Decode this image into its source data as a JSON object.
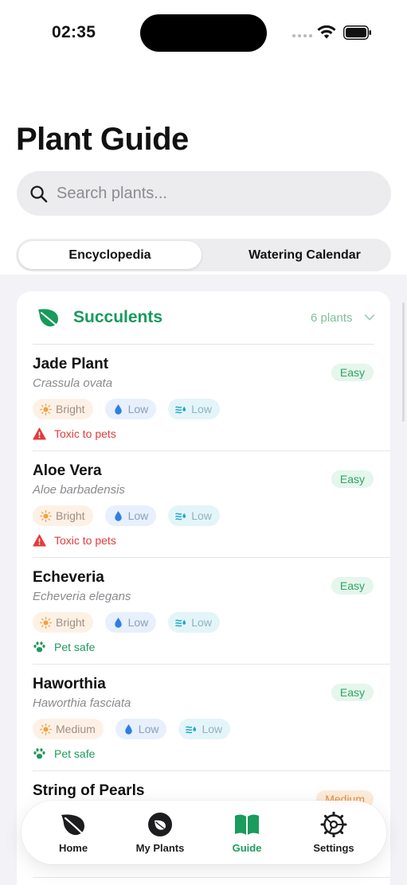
{
  "status_bar": {
    "time": "02:35"
  },
  "header": {
    "title": "Plant Guide"
  },
  "search": {
    "placeholder": "Search plants..."
  },
  "segments": [
    "Encyclopedia",
    "Watering Calendar"
  ],
  "category": {
    "name": "Succulents",
    "count_label": "6 plants"
  },
  "plants": [
    {
      "name": "Jade Plant",
      "scientific": "Crassula ovata",
      "difficulty": "Easy",
      "light": "Bright",
      "water": "Low",
      "humidity": "Low",
      "pet_note": "Toxic to pets",
      "pet_safe": false
    },
    {
      "name": "Aloe Vera",
      "scientific": "Aloe barbadensis",
      "difficulty": "Easy",
      "light": "Bright",
      "water": "Low",
      "humidity": "Low",
      "pet_note": "Toxic to pets",
      "pet_safe": false
    },
    {
      "name": "Echeveria",
      "scientific": "Echeveria elegans",
      "difficulty": "Easy",
      "light": "Bright",
      "water": "Low",
      "humidity": "Low",
      "pet_note": "Pet safe",
      "pet_safe": true
    },
    {
      "name": "Haworthia",
      "scientific": "Haworthia fasciata",
      "difficulty": "Easy",
      "light": "Medium",
      "water": "Low",
      "humidity": "Low",
      "pet_note": "Pet safe",
      "pet_safe": true
    },
    {
      "name": "String of Pearls",
      "scientific": "",
      "difficulty": "Medium",
      "light": "",
      "water": "",
      "humidity": "",
      "pet_note": "",
      "pet_safe": false
    }
  ],
  "tab_bar": {
    "tabs": [
      "Home",
      "My Plants",
      "Guide",
      "Settings"
    ],
    "active": "Guide"
  },
  "colors": {
    "accent_green": "#1b9b5d",
    "toxic_red": "#e23b3b",
    "easy_bg": "#e5f6ec",
    "medium_bg": "#fdebd9"
  },
  "icons": {
    "light": "sun-icon",
    "water": "droplet-icon",
    "humidity": "humidity-icon",
    "toxic": "warning-icon",
    "safe": "paw-icon",
    "category": "leaf-icon"
  }
}
